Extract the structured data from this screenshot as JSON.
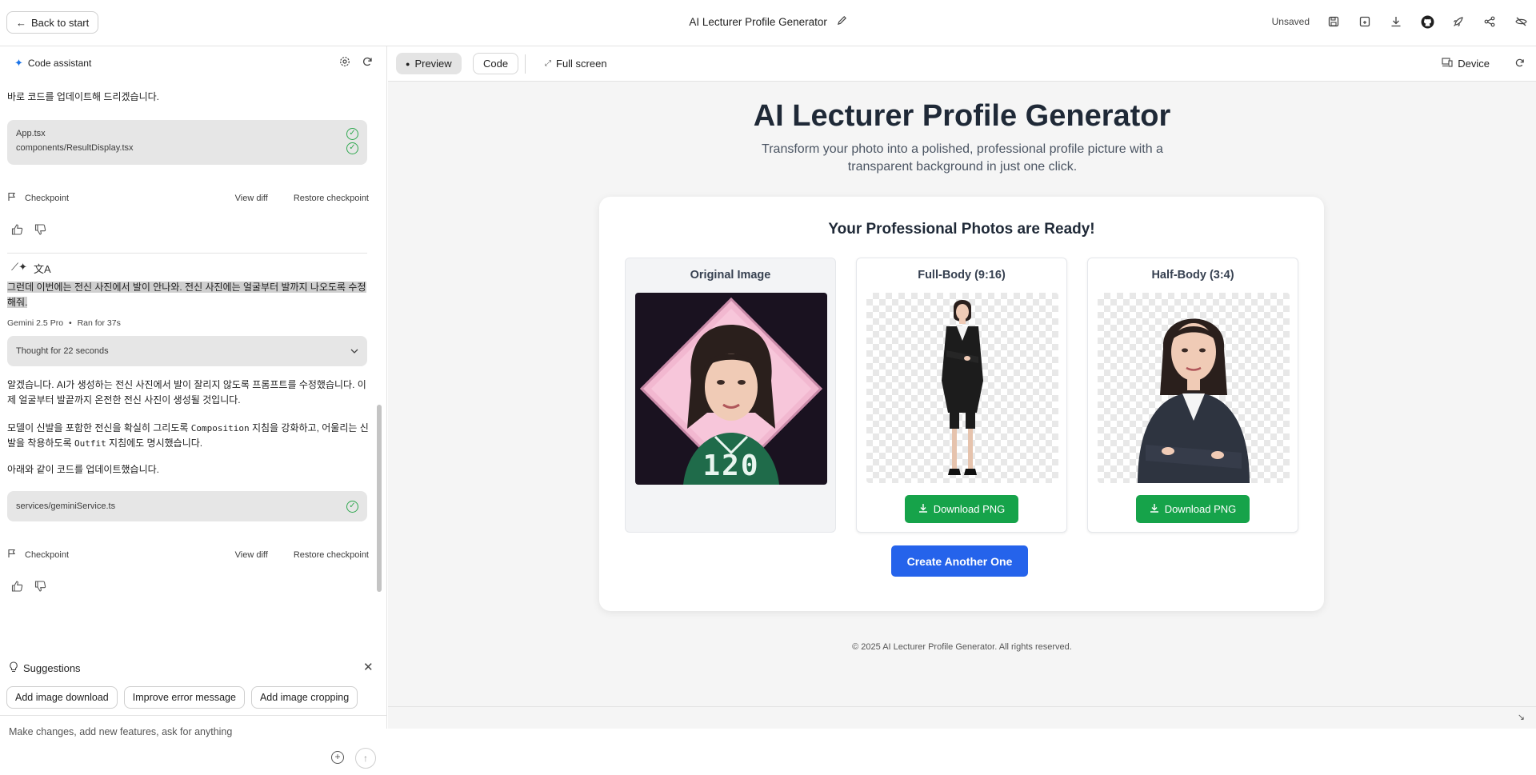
{
  "topbar": {
    "back_label": "Back to start",
    "title": "AI Lecturer Profile Generator",
    "status": "Unsaved"
  },
  "assistant": {
    "header": "Code assistant",
    "msg1": "바로 코드를 업데이트해 드리겠습니다.",
    "files1": [
      "App.tsx",
      "components/ResultDisplay.tsx"
    ],
    "checkpoint_label": "Checkpoint",
    "view_diff": "View diff",
    "restore": "Restore checkpoint",
    "user_msg": "그런데 이번에는 전신 사진에서 발이 안나와. 전신 사진에는 얼굴부터 발까지 나오도록 수정해줘.",
    "model": "Gemini 2.5 Pro",
    "ran_for": "Ran for 37s",
    "thought": "Thought for 22 seconds",
    "reply_p1": "알겠습니다. AI가 생성하는 전신 사진에서 발이 잘리지 않도록 프롬프트를 수정했습니다. 이제 얼굴부터 발끝까지 온전한 전신 사진이 생성될 것입니다.",
    "reply_p2_a": "모델이 신발을 포함한 전신을 확실히 그리도록 ",
    "reply_p2_code1": "Composition",
    "reply_p2_b": " 지침을 강화하고, 어울리는 신발을 착용하도록 ",
    "reply_p2_code2": "Outfit",
    "reply_p2_c": " 지침에도 명시했습니다.",
    "reply_p3": "아래와 같이 코드를 업데이트했습니다.",
    "files2": [
      "services/geminiService.ts"
    ]
  },
  "suggestions": {
    "title": "Suggestions",
    "chips": [
      "Add image download",
      "Improve error message",
      "Add image cropping"
    ]
  },
  "input": {
    "placeholder": "Make changes, add new features, ask for anything"
  },
  "preview_bar": {
    "preview": "Preview",
    "code": "Code",
    "fullscreen": "Full screen",
    "device": "Device"
  },
  "app": {
    "title": "AI Lecturer Profile Generator",
    "subtitle": "Transform your photo into a polished, professional profile picture with a transparent background in just one click.",
    "card_title": "Your Professional Photos are Ready!",
    "panels": [
      {
        "title": "Original Image"
      },
      {
        "title": "Full-Body (9:16)",
        "button": "Download PNG"
      },
      {
        "title": "Half-Body (3:4)",
        "button": "Download PNG"
      }
    ],
    "original_badge_number": "120",
    "create_another": "Create Another One",
    "footer": "© 2025 AI Lecturer Profile Generator. All rights reserved."
  },
  "colors": {
    "accent_blue": "#2563eb",
    "download_green": "#16a34a",
    "check_green": "#2fa84f"
  }
}
